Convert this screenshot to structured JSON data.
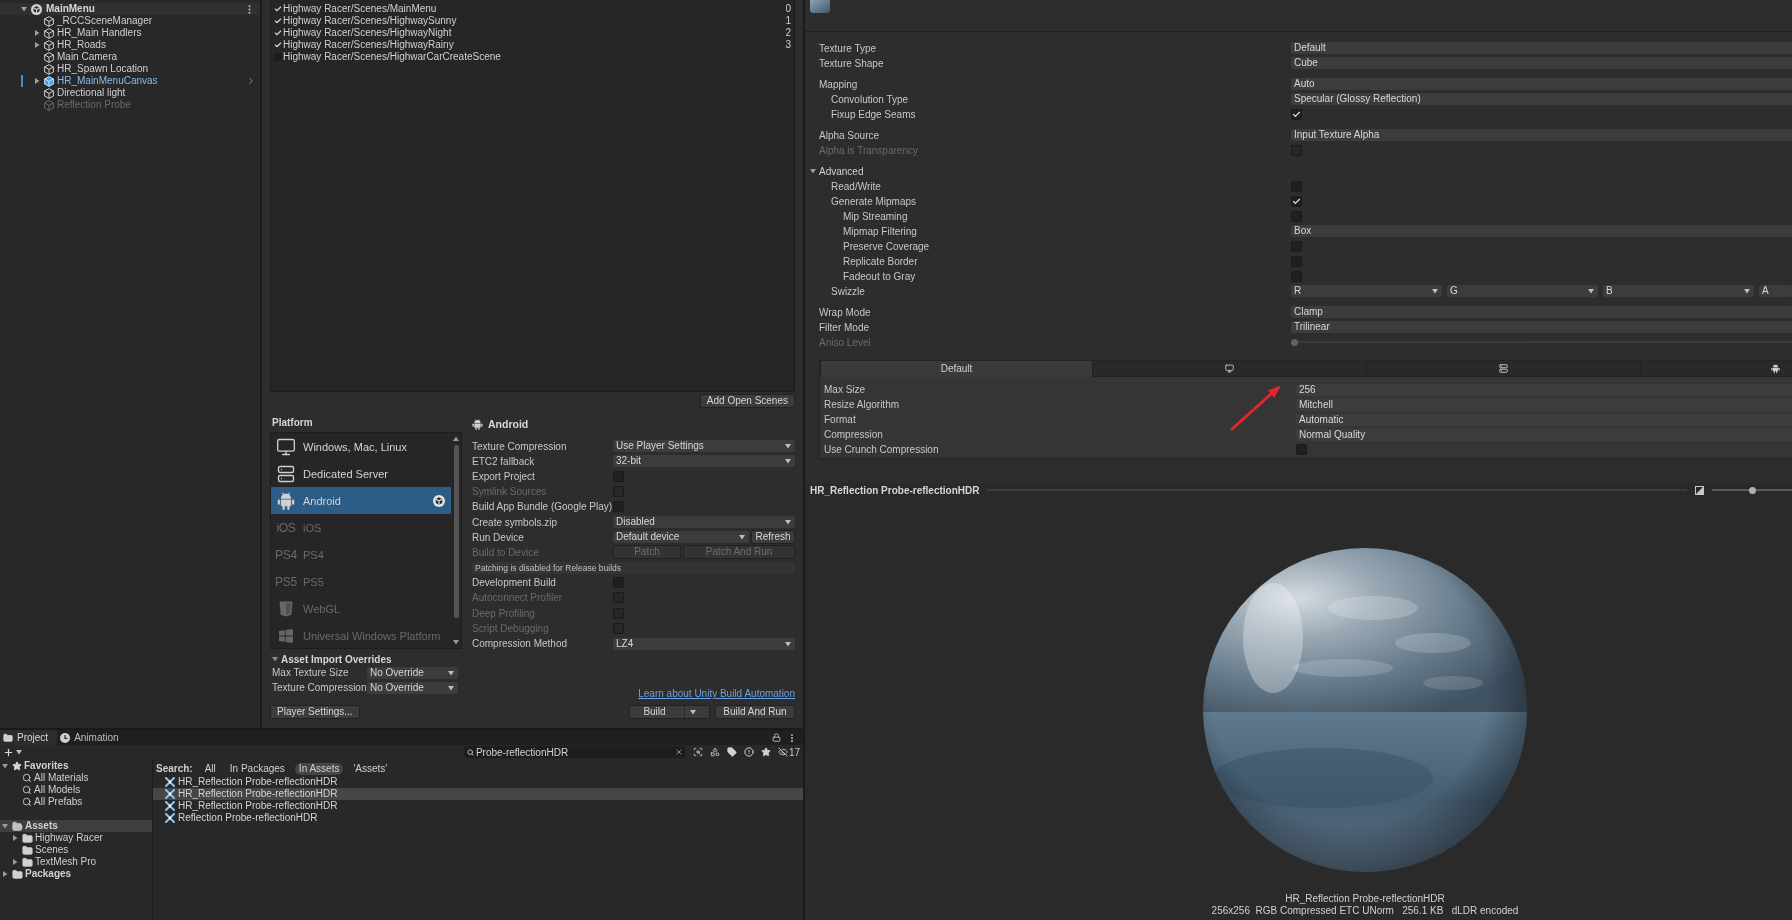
{
  "hierarchy": {
    "scene": "MainMenu",
    "items": [
      {
        "name": "_RCCSceneManager",
        "kind": "object",
        "expandable": false,
        "active": true
      },
      {
        "name": "HR_Main Handlers",
        "kind": "object",
        "expandable": true,
        "active": true
      },
      {
        "name": "HR_Roads",
        "kind": "object",
        "expandable": true,
        "active": true
      },
      {
        "name": "Main Camera",
        "kind": "object",
        "expandable": false,
        "active": true
      },
      {
        "name": "HR_Spawn Location",
        "kind": "object",
        "expandable": false,
        "active": true
      },
      {
        "name": "HR_MainMenuCanvas",
        "kind": "prefab",
        "expandable": true,
        "active": true
      },
      {
        "name": "Directional light",
        "kind": "object",
        "expandable": false,
        "active": true
      },
      {
        "name": "Reflection Probe",
        "kind": "object",
        "expandable": false,
        "active": false
      }
    ]
  },
  "build_settings": {
    "scenes": [
      {
        "path": "Highway Racer/Scenes/MainMenu",
        "checked": true,
        "index": "0"
      },
      {
        "path": "Highway Racer/Scenes/HighwaySunny",
        "checked": true,
        "index": "1"
      },
      {
        "path": "Highway Racer/Scenes/HighwayNight",
        "checked": true,
        "index": "2"
      },
      {
        "path": "Highway Racer/Scenes/HighwayRainy",
        "checked": true,
        "index": "3"
      },
      {
        "path": "Highway Racer/Scenes/HighwarCarCreateScene",
        "checked": false
      }
    ],
    "add_open_scenes": "Add Open Scenes",
    "platform_heading": "Platform",
    "platforms": [
      {
        "name": "Windows, Mac, Linux",
        "kind": "desktop",
        "installed": true,
        "selected": false,
        "active_target": false
      },
      {
        "name": "Dedicated Server",
        "kind": "server",
        "installed": true,
        "selected": false,
        "active_target": false
      },
      {
        "name": "Android",
        "kind": "android",
        "installed": true,
        "selected": true,
        "active_target": true
      },
      {
        "name": "iOS",
        "kind": "logo",
        "logo": "iOS",
        "installed": false,
        "selected": false,
        "active_target": false
      },
      {
        "name": "PS4",
        "kind": "logo",
        "logo": "PS4",
        "installed": false,
        "selected": false,
        "active_target": false
      },
      {
        "name": "PS5",
        "kind": "logo",
        "logo": "PS5",
        "installed": false,
        "selected": false,
        "active_target": false
      },
      {
        "name": "WebGL",
        "kind": "html5",
        "installed": false,
        "selected": false,
        "active_target": false
      },
      {
        "name": "Universal Windows Platform",
        "kind": "windows",
        "installed": false,
        "selected": false,
        "active_target": false
      }
    ],
    "target": {
      "title": "Android",
      "rows": [
        {
          "kind": "dropdown",
          "label": "Texture Compression",
          "value": "Use Player Settings",
          "disabled": false
        },
        {
          "kind": "dropdown",
          "label": "ETC2 fallback",
          "value": "32-bit",
          "disabled": false
        },
        {
          "kind": "checkbox",
          "label": "Export Project",
          "checked": false,
          "disabled": false
        },
        {
          "kind": "checkbox",
          "label": "Symlink Sources",
          "checked": false,
          "disabled": true
        },
        {
          "kind": "checkbox",
          "label": "Build App Bundle (Google Play)",
          "checked": false,
          "disabled": false
        },
        {
          "kind": "dropdown",
          "label": "Create symbols.zip",
          "value": "Disabled",
          "disabled": false
        },
        {
          "kind": "device",
          "label": "Run Device",
          "value": "Default device",
          "button": "Refresh",
          "disabled": false
        },
        {
          "kind": "buttons",
          "label": "Build to Device",
          "buttons": [
            "Patch",
            "Patch And Run"
          ],
          "disabled": true
        },
        {
          "kind": "notice",
          "text": "Patching is disabled for Release builds",
          "disabled": false
        },
        {
          "kind": "checkbox",
          "label": "Development Build",
          "checked": false,
          "disabled": false
        },
        {
          "kind": "checkbox",
          "label": "Autoconnect Profiler",
          "checked": false,
          "disabled": true
        },
        {
          "kind": "checkbox",
          "label": "Deep Profiling",
          "checked": false,
          "disabled": true
        },
        {
          "kind": "checkbox",
          "label": "Script Debugging",
          "checked": false,
          "disabled": true
        },
        {
          "kind": "dropdown",
          "label": "Compression Method",
          "value": "LZ4",
          "disabled": false
        }
      ]
    },
    "overrides": {
      "title": "Asset Import Overrides",
      "expanded": true,
      "rows": [
        {
          "label": "Max Texture Size",
          "value": "No Override"
        },
        {
          "label": "Texture Compression",
          "value": "No Override"
        }
      ]
    },
    "player_settings": "Player Settings...",
    "automation_link": "Learn about Unity Build Automation",
    "build": "Build",
    "build_and_run": "Build And Run"
  },
  "project": {
    "tabs": [
      {
        "label": "Project",
        "kind": "project",
        "selected": true
      },
      {
        "label": "Animation",
        "kind": "animation",
        "selected": false
      }
    ],
    "search": {
      "value": "Probe-reflectionHDR"
    },
    "hidden_count": "17",
    "favorites": {
      "label": "Favorites",
      "expanded": true,
      "items": [
        {
          "label": "All Materials",
          "selected": false
        },
        {
          "label": "All Models",
          "selected": false
        },
        {
          "label": "All Prefabs",
          "selected": false
        }
      ]
    },
    "tree": [
      {
        "label": "Assets",
        "expandable": true,
        "expanded": true,
        "selected": true,
        "children": [
          {
            "label": "Highway Racer",
            "expandable": true,
            "expanded": false,
            "selected": false
          },
          {
            "label": "Scenes",
            "expandable": false,
            "selected": false
          },
          {
            "label": "TextMesh Pro",
            "expandable": true,
            "expanded": false,
            "selected": false
          }
        ]
      },
      {
        "label": "Packages",
        "expandable": true,
        "expanded": false,
        "selected": false
      }
    ],
    "scope_label": "Search:",
    "scopes": [
      {
        "label": "All",
        "selected": false
      },
      {
        "label": "In Packages",
        "selected": false
      },
      {
        "label": "In Assets",
        "selected": true
      },
      {
        "label": "'Assets'",
        "selected": false
      }
    ],
    "results": [
      {
        "name": "HR_Reflection Probe-reflectionHDR",
        "selected": false
      },
      {
        "name": "HR_Reflection Probe-reflectionHDR",
        "selected": true
      },
      {
        "name": "HR_Reflection Probe-reflectionHDR",
        "selected": false
      },
      {
        "name": "Reflection Probe-reflectionHDR",
        "selected": false
      }
    ]
  },
  "inspector": {
    "groups": [
      {
        "rows": [
          {
            "kind": "dropdown",
            "label": "Texture Type",
            "value": "Default",
            "disabled": false
          },
          {
            "kind": "dropdown",
            "label": "Texture Shape",
            "value": "Cube",
            "disabled": false
          }
        ]
      },
      {
        "rows": [
          {
            "kind": "dropdown",
            "label": "Mapping",
            "value": "Auto",
            "disabled": false,
            "children": [
              {
                "kind": "dropdown",
                "label": "Convolution Type",
                "value": "Specular (Glossy Reflection)",
                "disabled": false
              },
              {
                "kind": "checkbox",
                "label": "Fixup Edge Seams",
                "checked": true,
                "disabled": false
              }
            ]
          }
        ]
      },
      {
        "rows": [
          {
            "kind": "dropdown",
            "label": "Alpha Source",
            "value": "Input Texture Alpha",
            "disabled": false
          },
          {
            "kind": "checkbox",
            "label": "Alpha is Transparency",
            "checked": false,
            "disabled": true
          }
        ]
      },
      {
        "rows": [
          {
            "kind": "section",
            "label": "Advanced",
            "expanded": true,
            "children": [
              {
                "kind": "checkbox",
                "label": "Read/Write",
                "checked": false,
                "disabled": false
              },
              {
                "kind": "checkbox",
                "label": "Generate Mipmaps",
                "checked": true,
                "disabled": false,
                "children": [
                  {
                    "kind": "checkbox",
                    "label": "Mip Streaming",
                    "checked": false,
                    "disabled": false
                  },
                  {
                    "kind": "dropdown",
                    "label": "Mipmap Filtering",
                    "value": "Box",
                    "disabled": false
                  },
                  {
                    "kind": "checkbox",
                    "label": "Preserve Coverage",
                    "checked": false,
                    "disabled": false
                  },
                  {
                    "kind": "checkbox",
                    "label": "Replicate Border",
                    "checked": false,
                    "disabled": false
                  },
                  {
                    "kind": "checkbox",
                    "label": "Fadeout to Gray",
                    "checked": false,
                    "disabled": false
                  }
                ]
              },
              {
                "kind": "swizzle",
                "label": "Swizzle",
                "values": [
                  "R",
                  "G",
                  "B",
                  "A"
                ],
                "disabled": false
              }
            ]
          }
        ]
      },
      {
        "rows": [
          {
            "kind": "dropdown",
            "label": "Wrap Mode",
            "value": "Clamp",
            "disabled": false
          },
          {
            "kind": "dropdown",
            "label": "Filter Mode",
            "value": "Trilinear",
            "disabled": false
          },
          {
            "kind": "slider",
            "label": "Aniso Level",
            "level": 0,
            "disabled": true
          }
        ]
      }
    ],
    "platform_tabs": [
      {
        "kind": "default",
        "label": "Default",
        "selected": true
      },
      {
        "kind": "desktop",
        "selected": false
      },
      {
        "kind": "server",
        "selected": false
      },
      {
        "kind": "android",
        "selected": false
      }
    ],
    "platform_rows": [
      {
        "kind": "dropdown",
        "label": "Max Size",
        "value": "256",
        "disabled": false
      },
      {
        "kind": "dropdown",
        "label": "Resize Algorithm",
        "value": "Mitchell",
        "disabled": false
      },
      {
        "kind": "dropdown",
        "label": "Format",
        "value": "Automatic",
        "disabled": false
      },
      {
        "kind": "dropdown",
        "label": "Compression",
        "value": "Normal Quality",
        "disabled": false
      },
      {
        "kind": "checkbox",
        "label": "Use Crunch Compression",
        "checked": false,
        "disabled": false
      }
    ],
    "preview": {
      "title": "HR_Reflection Probe-reflectionHDR",
      "level": 0.5,
      "caption": "HR_Reflection Probe-reflectionHDR",
      "info": "256x256  RGB Compressed ETC UNorm   256.1 KB   dLDR encoded"
    }
  }
}
